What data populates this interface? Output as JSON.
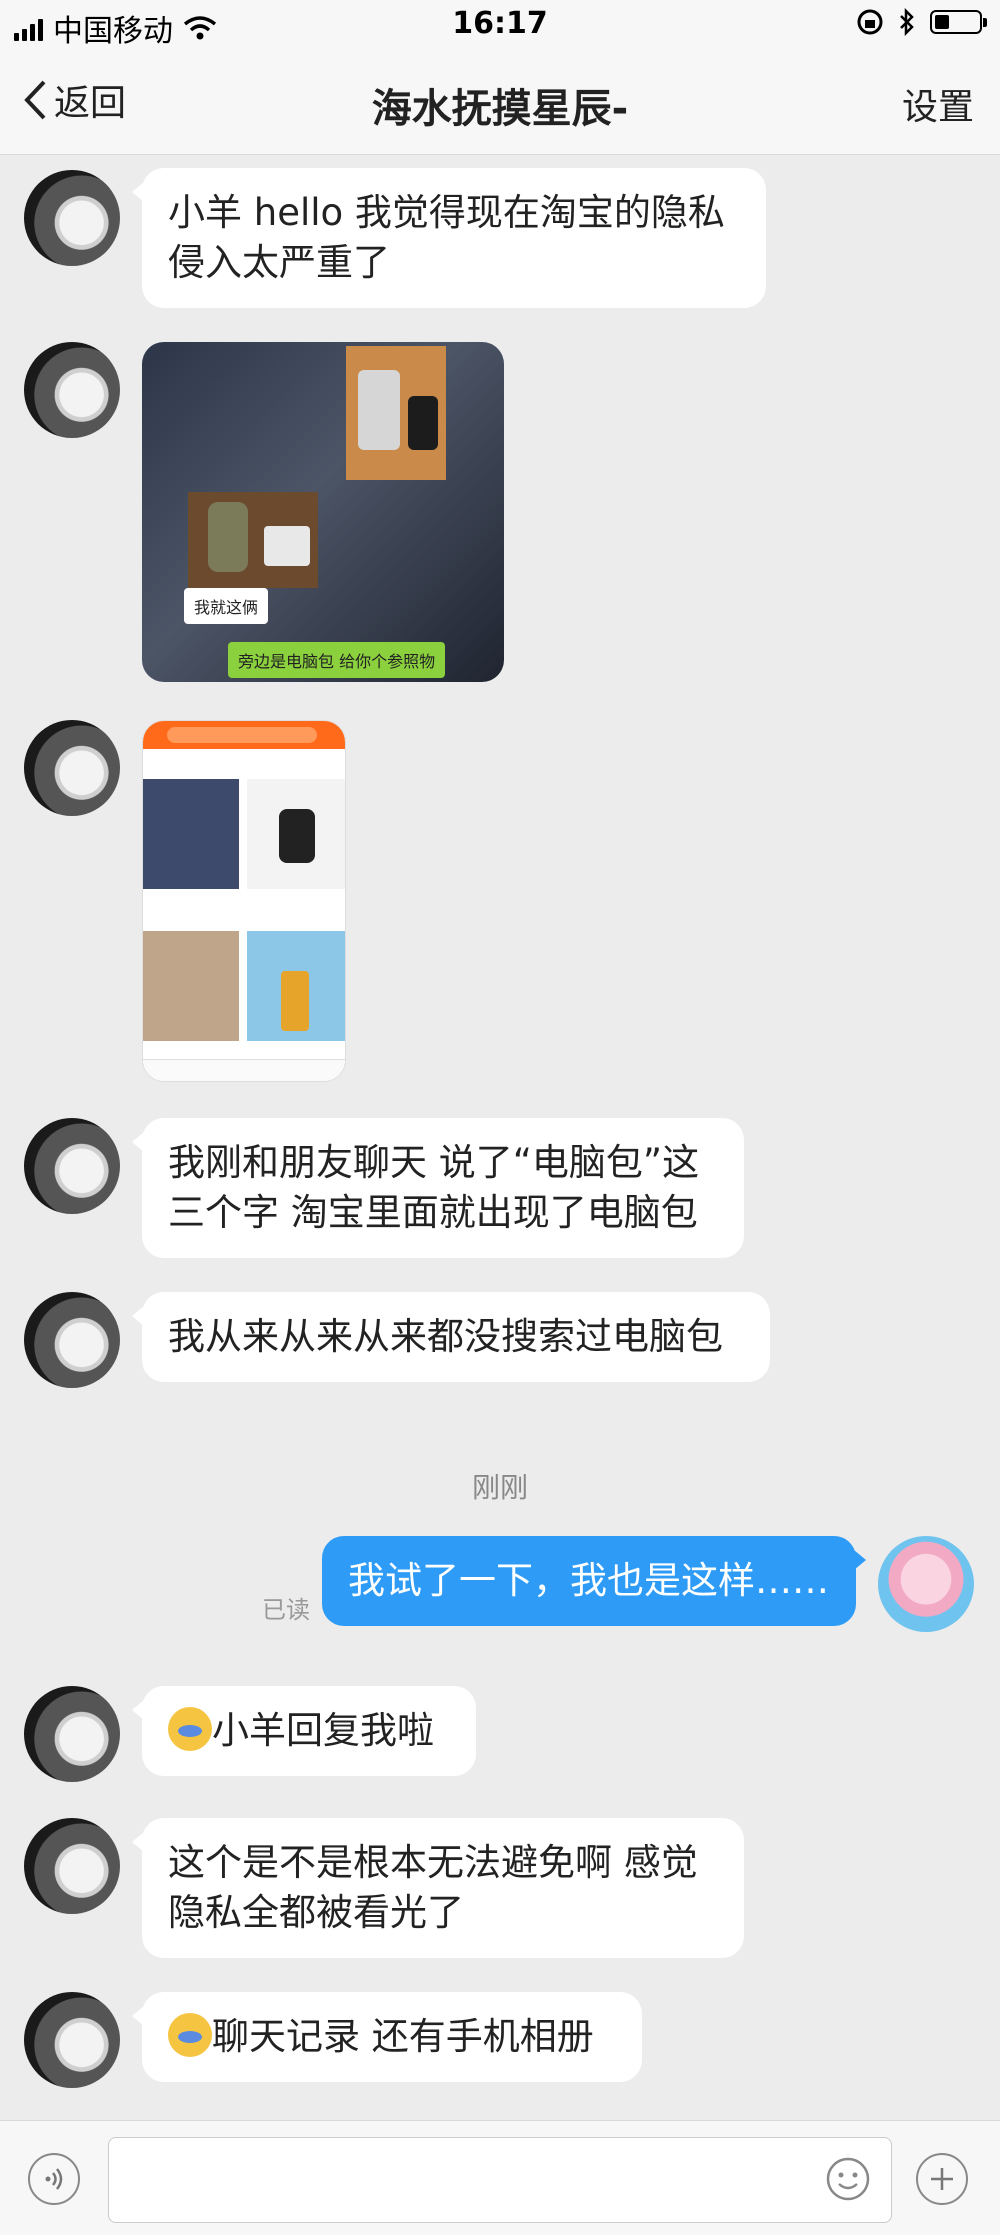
{
  "status_bar": {
    "carrier": "中国移动",
    "time": "16:17"
  },
  "nav": {
    "back_label": "返回",
    "title": "海水抚摸星辰-",
    "settings_label": "设置"
  },
  "messages": {
    "m1": {
      "text_line1": "小羊 hello 我觉得现在淘宝的隐私",
      "text_line2": "侵入太严重了"
    },
    "img1": {
      "caption1": "我就这俩",
      "caption2": "旁边是电脑包 给你个参照物"
    },
    "m3": {
      "text_line1": "我刚和朋友聊天 说了“电脑包”这",
      "text_line2": "三个字 淘宝里面就出现了电脑包"
    },
    "m4": {
      "text": "我从来从来从来都没搜索过电脑包"
    },
    "timestamp": "刚刚",
    "m5": {
      "text": "我试了一下，我也是这样……",
      "read_status": "已读"
    },
    "m6": {
      "text": "小羊回复我啦"
    },
    "m7": {
      "text_line1": "这个是不是根本无法避免啊 感觉",
      "text_line2": "隐私全都被看光了"
    },
    "m8": {
      "text": "聊天记录 还有手机相册"
    }
  },
  "colors": {
    "my_bubble": "#2e9cf6",
    "background": "#ececec"
  },
  "icons": {
    "back": "chevron-left-icon",
    "voice": "voice-icon",
    "emoji": "emoji-icon",
    "add": "plus-icon"
  }
}
